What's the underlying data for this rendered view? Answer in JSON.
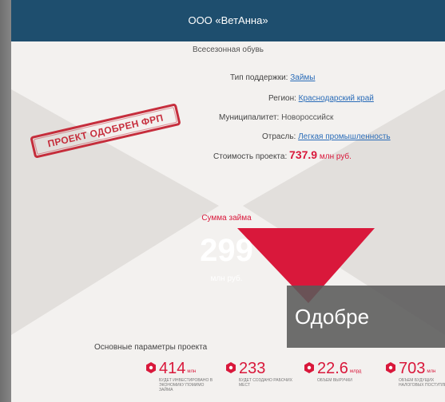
{
  "header": {
    "title": "ООО «ВетАнна»"
  },
  "subtitle": "Всесезонная обувь",
  "info": {
    "support_label": "Тип поддержки:",
    "support_value": "Займы",
    "region_label": "Регион:",
    "region_value": "Краснодарский край",
    "municipality_label": "Муниципалитет:",
    "municipality_value": "Новороссийск",
    "industry_label": "Отрасль:",
    "industry_value": "Легкая промышленность",
    "cost_label": "Стоимость проекта:",
    "cost_amount": "737.9",
    "cost_unit": "млн руб."
  },
  "stamp": {
    "text": "ПРОЕКТ ОДОБРЕН ФРП"
  },
  "loan": {
    "label": "Сумма займа",
    "amount": "299",
    "unit": "млн руб."
  },
  "overlay": {
    "text": "Одобре"
  },
  "params": {
    "title": "Основные параметры проекта",
    "stats": [
      {
        "value": "414",
        "unit": "млн",
        "caption": "будет инвестировано в экономику помимо займа"
      },
      {
        "value": "233",
        "unit": "",
        "caption": "будет создано рабочих мест"
      },
      {
        "value": "22.6",
        "unit": "млрд",
        "caption": "объем выручки"
      },
      {
        "value": "703",
        "unit": "млн",
        "caption": "объем будущих налоговых поступлений"
      }
    ]
  },
  "colors": {
    "header": "#1e4e6e",
    "accent": "#d9183b",
    "link": "#2a6cb8"
  }
}
